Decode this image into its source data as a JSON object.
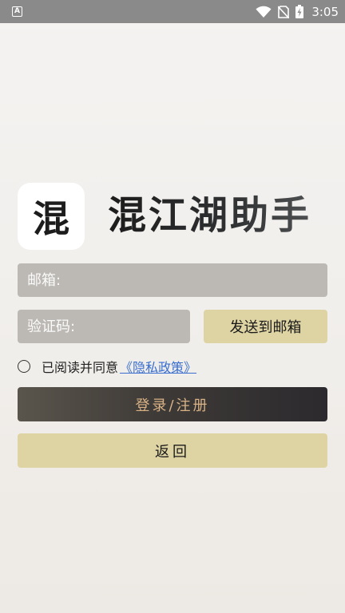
{
  "status_bar": {
    "app_icon_letter": "A",
    "time": "3:05",
    "icons": [
      "wifi-icon",
      "no-sim-icon",
      "battery-charging-icon"
    ]
  },
  "header": {
    "logo_text": "混",
    "title": "混江湖助手"
  },
  "form": {
    "email_placeholder": "邮箱:",
    "code_placeholder": "验证码:",
    "send_label": "发送到邮箱",
    "agree_text": "已阅读并同意",
    "policy_link": "《隐私政策》",
    "agree_checked": false
  },
  "actions": {
    "login_label": "登录/注册",
    "back_label": "返回"
  },
  "colors": {
    "status_bar": "#8a8a8a",
    "field_bg": "#bcb8b3",
    "gold_button": "#ddd3a3",
    "login_text": "#d9b386",
    "link": "#3a6fd0"
  }
}
